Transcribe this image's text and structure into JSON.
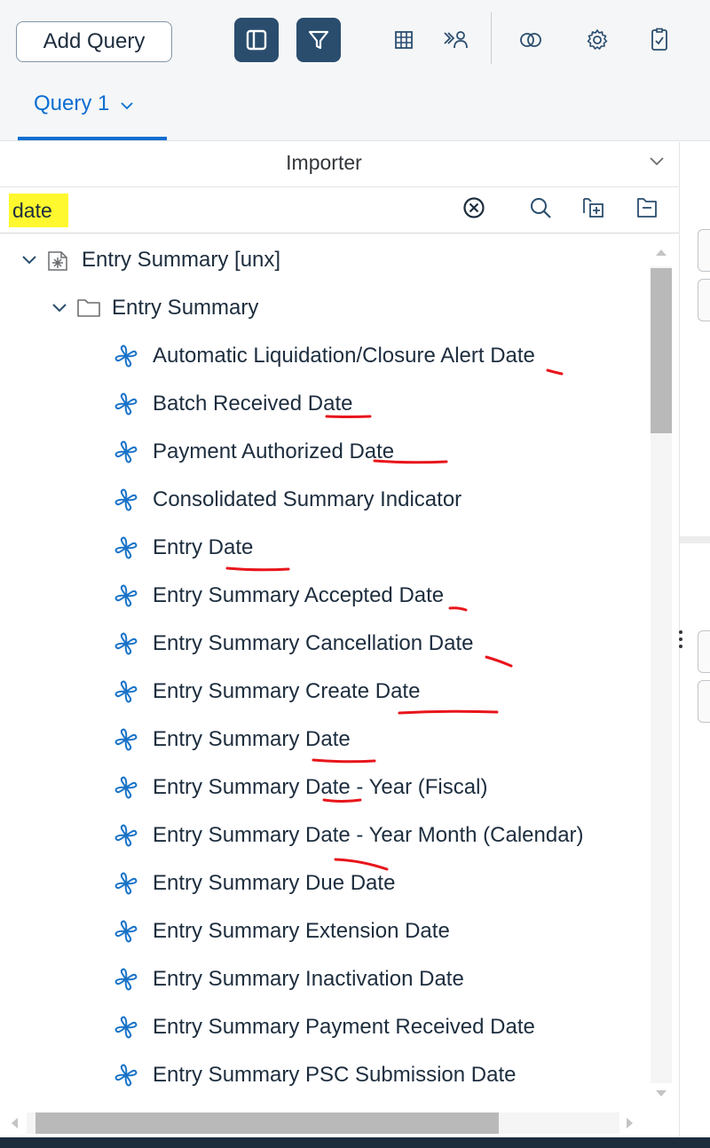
{
  "toolbar": {
    "add_query_label": "Add Query",
    "buttons": [
      {
        "name": "side-panel-icon",
        "active": true
      },
      {
        "name": "filter-icon",
        "active": true
      },
      {
        "name": "table-icon",
        "active": false
      },
      {
        "name": "combined-query-icon",
        "active": false
      },
      {
        "name": "linked-circles-icon",
        "active": false
      },
      {
        "name": "gear-icon",
        "active": false
      },
      {
        "name": "document-check-icon",
        "active": false
      }
    ]
  },
  "tabs": [
    {
      "label": "Query 1",
      "selected": true
    }
  ],
  "panel": {
    "title": "Importer"
  },
  "search": {
    "value": "date",
    "highlight_color": "#fff82e"
  },
  "tree": {
    "universe": {
      "label": "Entry Summary [unx]",
      "icon": "universe-icon"
    },
    "folder": {
      "label": "Entry Summary",
      "icon": "folder-icon"
    },
    "items": [
      {
        "label": "Automatic Liquidation/Closure Alert Date"
      },
      {
        "label": "Batch Received Date"
      },
      {
        "label": "Payment Authorized Date"
      },
      {
        "label": "Consolidated Summary Indicator"
      },
      {
        "label": "Entry Date"
      },
      {
        "label": "Entry Summary Accepted Date"
      },
      {
        "label": "Entry Summary Cancellation Date"
      },
      {
        "label": "Entry Summary Create Date"
      },
      {
        "label": "Entry Summary Date"
      },
      {
        "label": "Entry Summary Date - Year (Fiscal)"
      },
      {
        "label": "Entry Summary Date - Year Month (Calendar)"
      },
      {
        "label": "Entry Summary Due Date"
      },
      {
        "label": "Entry Summary Extension Date"
      },
      {
        "label": "Entry Summary Inactivation Date"
      },
      {
        "label": "Entry Summary Payment Received Date"
      },
      {
        "label": "Entry Summary PSC Submission Date"
      }
    ]
  },
  "colors": {
    "accent": "#0a6ed1",
    "active_button": "#2a4d6e",
    "dimension_icon": "#1a73c8",
    "annotation": "#e8151b",
    "highlight": "#fff82e"
  }
}
